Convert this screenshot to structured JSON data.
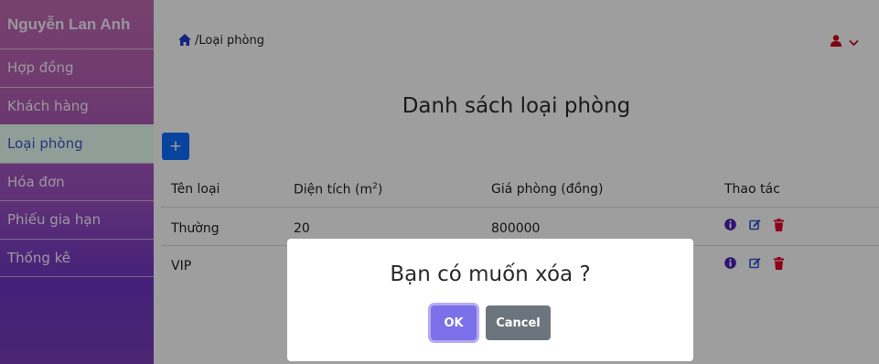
{
  "sidebar": {
    "brand": "Nguyễn Lan Anh",
    "items": [
      {
        "label": "Hợp đồng"
      },
      {
        "label": "Khách hàng"
      },
      {
        "label": "Loại phòng"
      },
      {
        "label": "Hóa đơn"
      },
      {
        "label": "Phiếu gia hạn"
      },
      {
        "label": "Thống kê"
      }
    ],
    "active_item": "Loại phòng"
  },
  "header": {
    "breadcrumb": "/Loại phòng",
    "home_icon": "home-icon",
    "user_icon": "user-icon",
    "dropdown_icon": "chevron-down-icon"
  },
  "main": {
    "title": "Danh sách loại phòng",
    "add_button_label": "+",
    "table": {
      "headers": [
        "Tên loại",
        "Diện tích (m",
        "2",
        ")",
        "Giá phòng (đồng)",
        "Thao tác"
      ],
      "rows": [
        {
          "name": "Thường",
          "area": "20",
          "price": "800000"
        },
        {
          "name": "VIP",
          "area": "",
          "price": ""
        }
      ],
      "action_icons": [
        "info-icon",
        "edit-icon",
        "trash-icon"
      ]
    }
  },
  "modal": {
    "message": "Bạn có muốn xóa ?",
    "ok_label": "OK",
    "cancel_label": "Cancel"
  },
  "colors": {
    "sidebar_gradient_top": "#c06ab1",
    "sidebar_gradient_bottom": "#6d35c4",
    "active_item_bg": "#e8fff6",
    "primary": "#0d6efd",
    "ok": "#7b70e7",
    "cancel": "#6c757d",
    "delete": "#e4002b",
    "info": "#4b1fb3"
  }
}
